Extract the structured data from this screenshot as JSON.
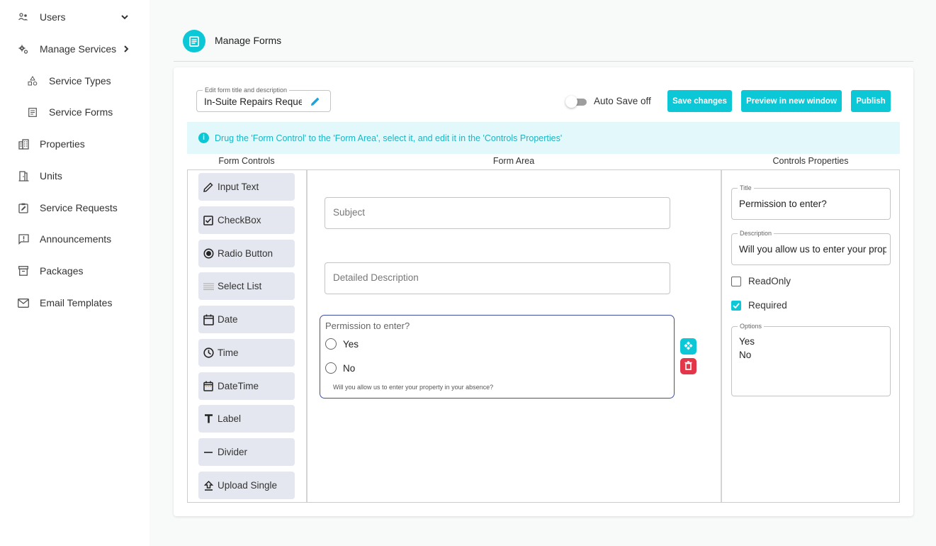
{
  "sidebar": {
    "items": [
      {
        "label": "Users",
        "icon": "users-icon",
        "chevron": "down"
      },
      {
        "label": "Manage Services",
        "icon": "gears-icon",
        "chevron": "right"
      },
      {
        "label": "Service Types",
        "icon": "shapes-icon",
        "sub": true
      },
      {
        "label": "Service Forms",
        "icon": "form-icon",
        "sub": true
      },
      {
        "label": "Properties",
        "icon": "building-icon"
      },
      {
        "label": "Units",
        "icon": "door-icon"
      },
      {
        "label": "Service Requests",
        "icon": "clipboard-edit-icon"
      },
      {
        "label": "Announcements",
        "icon": "announcement-icon"
      },
      {
        "label": "Packages",
        "icon": "package-icon"
      },
      {
        "label": "Email Templates",
        "icon": "mail-icon"
      }
    ]
  },
  "header": {
    "title": "Manage Forms",
    "icon": "form-icon"
  },
  "toolbar": {
    "title_field_legend": "Edit form title and description",
    "title_field_value": "In-Suite Repairs Request",
    "auto_save_label": "Auto Save off",
    "auto_save_on": false,
    "save_label": "Save changes",
    "preview_label": "Preview in new window",
    "publish_label": "Publish"
  },
  "info": {
    "text": "Drug the 'Form Control' to the 'Form Area', select it, and edit it in the 'Controls Properties'"
  },
  "columns": {
    "controls": "Form Controls",
    "area": "Form Area",
    "properties": "Controls Properties"
  },
  "form_controls": [
    {
      "label": "Input Text",
      "icon": "pencil-icon"
    },
    {
      "label": "CheckBox",
      "icon": "checkbox-icon"
    },
    {
      "label": "Radio Button",
      "icon": "radio-icon"
    },
    {
      "label": "Select List",
      "icon": "list-icon"
    },
    {
      "label": "Date",
      "icon": "calendar-icon"
    },
    {
      "label": "Time",
      "icon": "clock-icon"
    },
    {
      "label": "DateTime",
      "icon": "calendar-time-icon"
    },
    {
      "label": "Label",
      "icon": "text-icon"
    },
    {
      "label": "Divider",
      "icon": "divider-icon"
    },
    {
      "label": "Upload Single",
      "icon": "upload-icon"
    }
  ],
  "form_area": {
    "subject_placeholder": "Subject",
    "description_placeholder": "Detailed Description",
    "radio_group": {
      "title": "Permission to enter?",
      "options": [
        "Yes",
        "No"
      ],
      "description": "Will you allow us to enter your property in your absence?"
    }
  },
  "properties": {
    "title_legend": "Title",
    "title_value": "Permission to enter?",
    "description_legend": "Description",
    "description_value": "Will you allow us to enter your property in your absence?",
    "readonly_label": "ReadOnly",
    "readonly_checked": false,
    "required_label": "Required",
    "required_checked": true,
    "options_legend": "Options",
    "options": [
      "Yes",
      "No"
    ]
  },
  "colors": {
    "accent": "#0cc8d6",
    "danger": "#e2374a",
    "info_bg": "#e3f8fa",
    "selected_border": "#3f4fa0"
  }
}
